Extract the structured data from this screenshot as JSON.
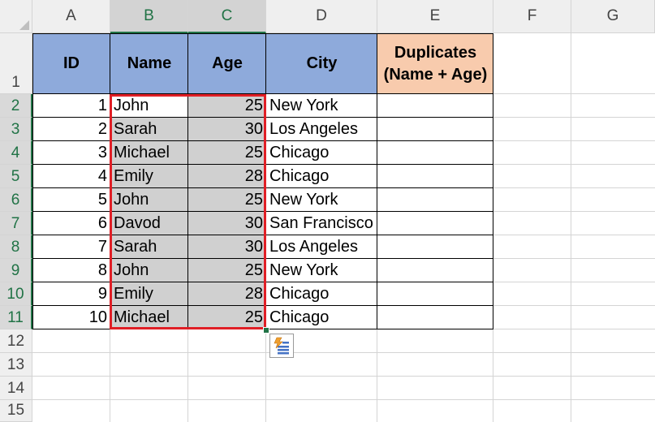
{
  "sheet": {
    "columns": [
      "A",
      "B",
      "C",
      "D",
      "E",
      "F",
      "G"
    ],
    "rows": [
      "1",
      "2",
      "3",
      "4",
      "5",
      "6",
      "7",
      "8",
      "9",
      "10",
      "11",
      "12",
      "13",
      "14",
      "15"
    ]
  },
  "table": {
    "headers": {
      "id": "ID",
      "name": "Name",
      "age": "Age",
      "city": "City",
      "duplicates_line1": "Duplicates",
      "duplicates_line2": "(Name + Age)"
    },
    "rows": [
      {
        "id": "1",
        "name": "John",
        "age": "25",
        "city": "New York"
      },
      {
        "id": "2",
        "name": "Sarah",
        "age": "30",
        "city": "Los Angeles"
      },
      {
        "id": "3",
        "name": "Michael",
        "age": "25",
        "city": "Chicago"
      },
      {
        "id": "4",
        "name": "Emily",
        "age": "28",
        "city": "Chicago"
      },
      {
        "id": "5",
        "name": "John",
        "age": "25",
        "city": "New York"
      },
      {
        "id": "6",
        "name": "Davod",
        "age": "30",
        "city": "San Francisco"
      },
      {
        "id": "7",
        "name": "Sarah",
        "age": "30",
        "city": "Los Angeles"
      },
      {
        "id": "8",
        "name": "John",
        "age": "25",
        "city": "New York"
      },
      {
        "id": "9",
        "name": "Emily",
        "age": "28",
        "city": "Chicago"
      },
      {
        "id": "10",
        "name": "Michael",
        "age": "25",
        "city": "Chicago"
      }
    ]
  },
  "colors": {
    "header_blue": "#8eaadb",
    "header_orange": "#f8cbad",
    "selection_gray": "#d0d0d0",
    "selection_border": "#e01f26",
    "excel_green": "#217346"
  },
  "icons": {
    "quick_analysis": "quick-analysis-icon"
  }
}
